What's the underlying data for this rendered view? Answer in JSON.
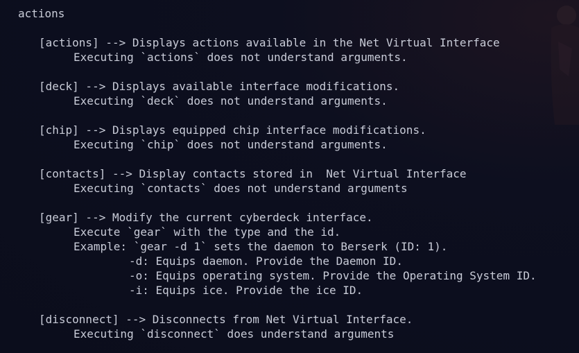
{
  "command": "actions",
  "lines": [
    "[actions] --> Displays actions available in the Net Virtual Interface",
    "Executing `actions` does not understand arguments.",
    "[deck] --> Displays available interface modifications.",
    "Executing `deck` does not understand arguments.",
    "[chip] --> Displays equipped chip interface modifications.",
    "Executing `chip` does not understand arguments.",
    "[contacts] --> Display contacts stored in  Net Virtual Interface",
    "Executing `contacts` does not understand arguments",
    "[gear] --> Modify the current cyberdeck interface.",
    "Execute `gear` with the type and the id.",
    "Example: `gear -d 1` sets the daemon to Berserk (ID: 1).",
    "-d: Equips daemon. Provide the Daemon ID.",
    "-o: Equips operating system. Provide the Operating System ID.",
    "-i: Equips ice. Provide the ice ID.",
    "[disconnect] --> Disconnects from Net Virtual Interface.",
    "Executing `disconnect` does understand arguments"
  ],
  "colors": {
    "background": "#0b0d1c",
    "text": "#c9ccd8"
  }
}
